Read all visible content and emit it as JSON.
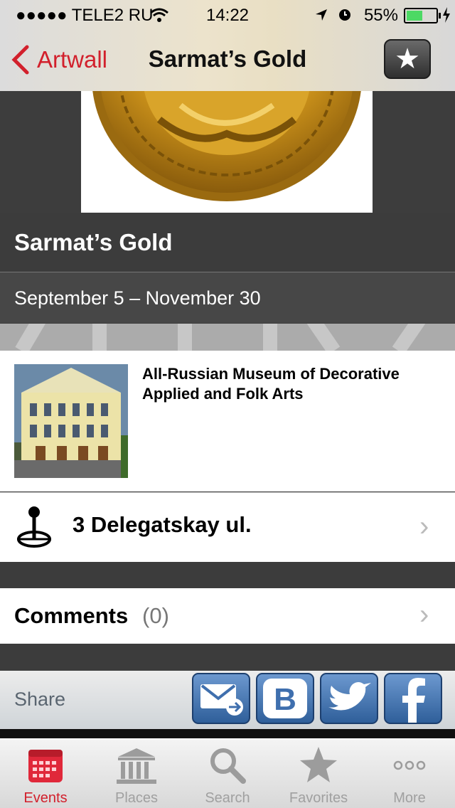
{
  "status_bar": {
    "carrier": "●●●●● TELE2 RU",
    "time": "14:22",
    "battery": "55%",
    "battery_level": 0.55
  },
  "nav": {
    "back_label": "Artwall",
    "title": "Sarmat’s Gold",
    "favorite_icon": "star-icon"
  },
  "event": {
    "title": "Sarmat’s Gold",
    "dates": "September 5 – November 30"
  },
  "place": {
    "name": "All-Russian Museum of Decorative Applied and Folk Arts",
    "address": "3 Delegatskay ul."
  },
  "comments": {
    "label": "Comments",
    "count": "(0)"
  },
  "share": {
    "label": "Share",
    "buttons": [
      "mail-icon",
      "vk-icon",
      "twitter-icon",
      "facebook-icon"
    ]
  },
  "tabs": [
    {
      "label": "Events",
      "icon": "calendar-icon",
      "active": true
    },
    {
      "label": "Places",
      "icon": "building-icon",
      "active": false
    },
    {
      "label": "Search",
      "icon": "search-icon",
      "active": false
    },
    {
      "label": "Favorites",
      "icon": "star-icon",
      "active": false
    },
    {
      "label": "More",
      "icon": "more-icon",
      "active": false
    }
  ],
  "colors": {
    "accent": "#d2202c",
    "band_dark": "#3c3c3c",
    "share_button": "#3f6fae"
  }
}
